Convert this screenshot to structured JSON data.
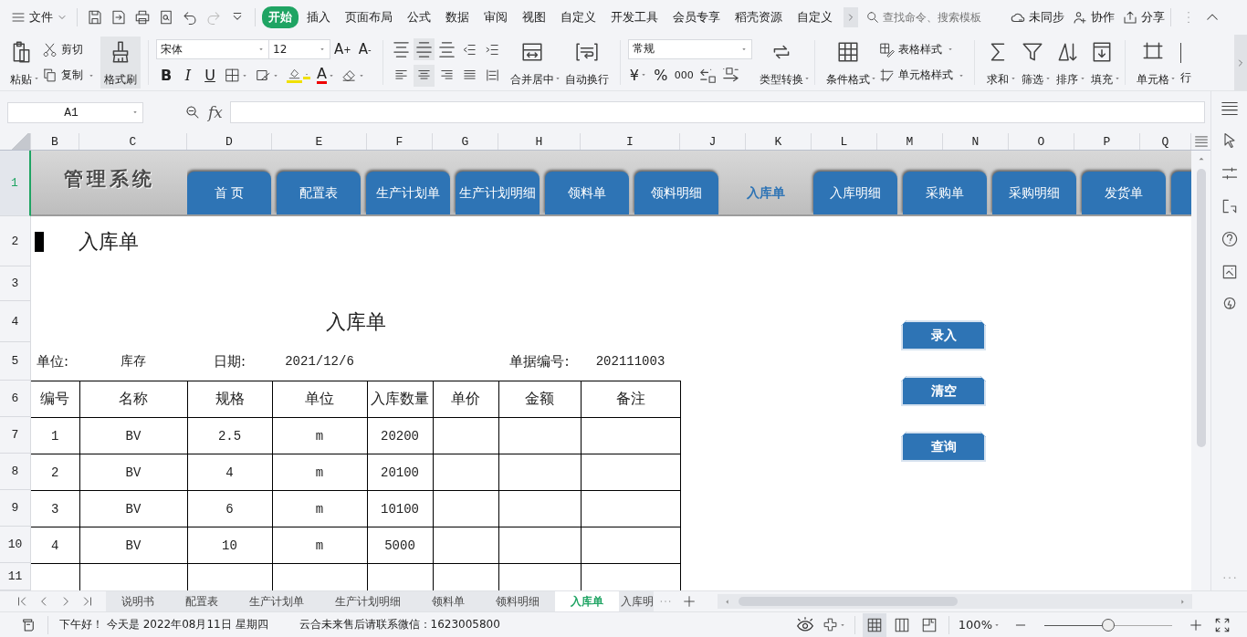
{
  "menu_bar": {
    "file_menu": "文件",
    "tabs": [
      {
        "label": "开始",
        "selected": true
      },
      {
        "label": "插入",
        "selected": false
      },
      {
        "label": "页面布局",
        "selected": false
      },
      {
        "label": "公式",
        "selected": false
      },
      {
        "label": "数据",
        "selected": false
      },
      {
        "label": "审阅",
        "selected": false
      },
      {
        "label": "视图",
        "selected": false
      },
      {
        "label": "自定义",
        "selected": false
      },
      {
        "label": "开发工具",
        "selected": false
      },
      {
        "label": "会员专享",
        "selected": false
      },
      {
        "label": "稻壳资源",
        "selected": false
      },
      {
        "label": "自定义",
        "selected": false
      }
    ],
    "search": {
      "placeholder": "查找命令、搜索模板"
    },
    "actions": [
      {
        "kind": "sync",
        "label": "未同步"
      },
      {
        "kind": "collab",
        "label": "协作"
      },
      {
        "kind": "share",
        "label": "分享"
      }
    ]
  },
  "ribbon": {
    "paste": "粘贴",
    "cut": "剪切",
    "copy": "复制",
    "format_painter": "格式刷",
    "font": "宋体",
    "font_size": "12",
    "grow_font": "A$^{+}$",
    "shrink_font": "A$^{-}$",
    "bold": "B",
    "italic": "I",
    "underline": "U",
    "font_color": "A",
    "merge": "合并居中",
    "wrap": "自动换行",
    "number_format": "常规",
    "currency": "¥",
    "percent": "%",
    "thousands": "000",
    "convert": "类型转换",
    "conditional": "条件格式",
    "table_style": "表格样式",
    "cell_style": "单元格样式",
    "sum": "求和",
    "filter": "筛选",
    "sort": "排序",
    "fill": "填充",
    "cell": "单元格",
    "row": "行"
  },
  "formula_bar": {
    "cell_ref": "A1",
    "fx": "fx"
  },
  "column_headers": [
    "B",
    "C",
    "D",
    "E",
    "F",
    "G",
    "H",
    "I",
    "J",
    "K",
    "L",
    "M",
    "N",
    "O",
    "P",
    "Q"
  ],
  "row_headers": [
    {
      "label": "1",
      "active": true
    },
    {
      "label": "2",
      "active": false
    },
    {
      "label": "3",
      "active": false
    },
    {
      "label": "4",
      "active": false
    },
    {
      "label": "5",
      "active": false
    },
    {
      "label": "6",
      "active": false
    },
    {
      "label": "7",
      "active": false
    },
    {
      "label": "8",
      "active": false
    },
    {
      "label": "9",
      "active": false
    },
    {
      "label": "10",
      "active": false
    },
    {
      "label": "11",
      "active": false
    }
  ],
  "banner": {
    "title": "管理系统",
    "nav": [
      {
        "label": "首 页",
        "selected": false
      },
      {
        "label": "配置表",
        "selected": false
      },
      {
        "label": "生产计划单",
        "selected": false
      },
      {
        "label": "生产计划明细",
        "selected": false
      },
      {
        "label": "领料单",
        "selected": false
      },
      {
        "label": "领料明细",
        "selected": false
      },
      {
        "label": "入库单",
        "selected": true
      },
      {
        "label": "入库明细",
        "selected": false
      },
      {
        "label": "采购单",
        "selected": false
      },
      {
        "label": "采购明细",
        "selected": false
      },
      {
        "label": "发货单",
        "selected": false
      },
      {
        "selected": false
      }
    ]
  },
  "heading": "入库单",
  "form": {
    "title": "入库单",
    "info": [
      {
        "label": "单位:",
        "value": "库存"
      },
      {
        "label": "日期:",
        "value": "2021/12/6"
      },
      {
        "label": "单据编号:",
        "value": "202111003"
      }
    ],
    "table": {
      "columns": [
        "编号",
        "名称",
        "规格",
        "单位",
        "入库数量",
        "单价",
        "金额",
        "备注"
      ],
      "rows": [
        [
          "1",
          "BV",
          "2.5",
          "m",
          "20200"
        ],
        [
          "2",
          "BV",
          "4",
          "m",
          "20100"
        ],
        [
          "3",
          "BV",
          "6",
          "m",
          "10100"
        ],
        [
          "4",
          "BV",
          "10",
          "m",
          "5000"
        ]
      ]
    }
  },
  "buttons": [
    "录入",
    "清空",
    "查询"
  ],
  "sheet_tabs": [
    {
      "label": "说明书",
      "selected": false
    },
    {
      "label": "配置表",
      "selected": false
    },
    {
      "label": "生产计划单",
      "selected": false
    },
    {
      "label": "生产计划明细",
      "selected": false
    },
    {
      "label": "领料单",
      "selected": false
    },
    {
      "label": "领料明细",
      "selected": false
    },
    {
      "label": "入库单",
      "selected": true
    },
    {
      "label": "入库明",
      "selected": false
    }
  ],
  "status_bar": {
    "greeting": "下午好！ 今天是 2022年08月11日 星期四",
    "contact": "云合未来售后请联系微信：1623005800",
    "view_modes": [
      {
        "kind": "normal",
        "selected": true
      },
      {
        "kind": "page",
        "selected": false
      },
      {
        "kind": "break",
        "selected": false
      }
    ],
    "zoom": "100%",
    "zoom_slider": {
      "level": 0.5
    }
  }
}
